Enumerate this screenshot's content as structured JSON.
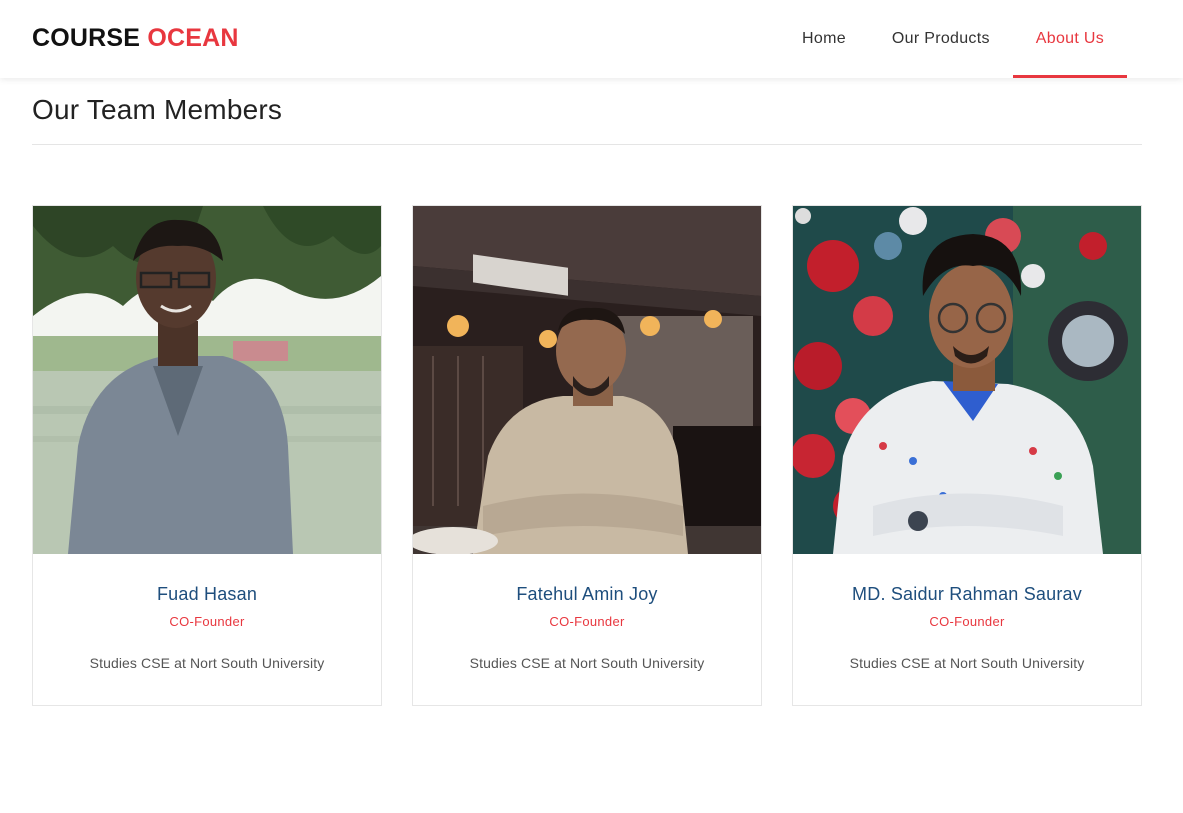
{
  "brand": {
    "part1": "COURSE",
    "part2": "OCEAN",
    "accent_color": "#e8373f"
  },
  "nav": {
    "items": [
      {
        "label": "Home",
        "active": false
      },
      {
        "label": "Our Products",
        "active": false
      },
      {
        "label": "About Us",
        "active": true
      }
    ]
  },
  "section": {
    "title": "Our Team Members"
  },
  "members": [
    {
      "name": "Fuad Hasan",
      "role": "CO-Founder",
      "description": "Studies CSE at Nort South University",
      "photo": "portrait-photo"
    },
    {
      "name": "Fatehul Amin Joy",
      "role": "CO-Founder",
      "description": "Studies CSE at Nort South University",
      "photo": "portrait-photo"
    },
    {
      "name": "MD. Saidur Rahman Saurav",
      "role": "CO-Founder",
      "description": "Studies CSE at Nort South University",
      "photo": "portrait-photo"
    }
  ],
  "colors": {
    "name_text": "#1e4e7d",
    "role_text": "#e8373f"
  }
}
